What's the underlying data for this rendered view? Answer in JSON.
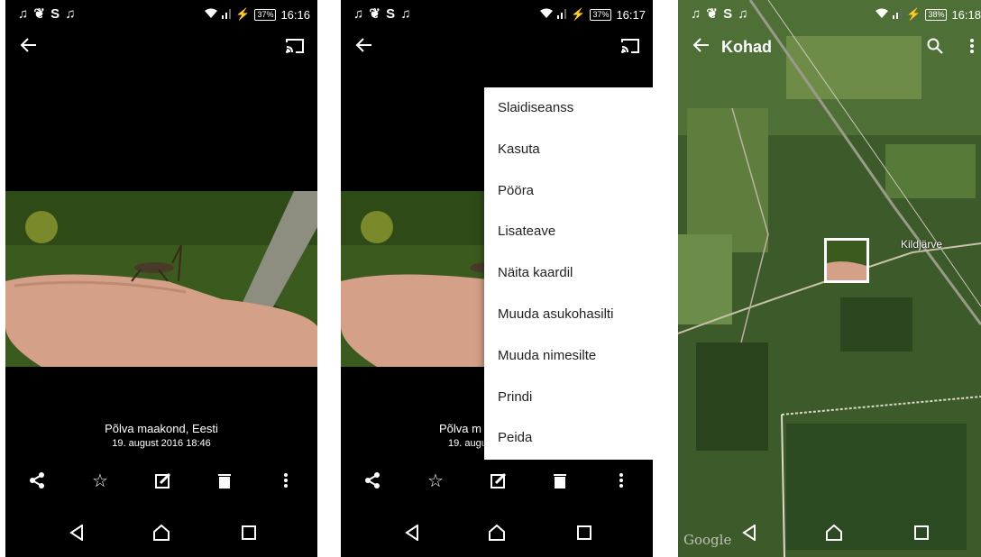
{
  "status_left": "♫ ❦ S ♫",
  "screens": [
    {
      "status_battery": "37%",
      "status_time": "16:16",
      "caption_location": "Põlva maakond, Eesti",
      "caption_date": "19. august 2016 18:46"
    },
    {
      "status_battery": "37%",
      "status_time": "16:17",
      "caption_location": "Põlva m",
      "caption_date": "19. augu"
    },
    {
      "status_battery": "38%",
      "status_time": "16:18",
      "app_title": "Kohad",
      "place_label": "Kildjärve",
      "map_brand": "Google"
    }
  ],
  "menu": {
    "items": [
      "Slaidiseanss",
      "Kasuta",
      "Pööra",
      "Lisateave",
      "Näita kaardil",
      "Muuda asukohasilti",
      "Muuda nimesilte",
      "Prindi",
      "Peida"
    ]
  },
  "icons": {
    "back": "arrow-left-icon",
    "cast": "cast-icon",
    "share": "share-icon",
    "favorite": "star-icon",
    "edit": "edit-icon",
    "delete": "trash-icon",
    "more": "more-vert-icon",
    "nav_back": "nav-back-icon",
    "nav_home": "nav-home-icon",
    "nav_recent": "nav-recent-icon",
    "search": "search-icon"
  },
  "colors": {
    "background": "#000000",
    "menu_bg": "#ffffff",
    "map_green": "#3d5a2a"
  }
}
